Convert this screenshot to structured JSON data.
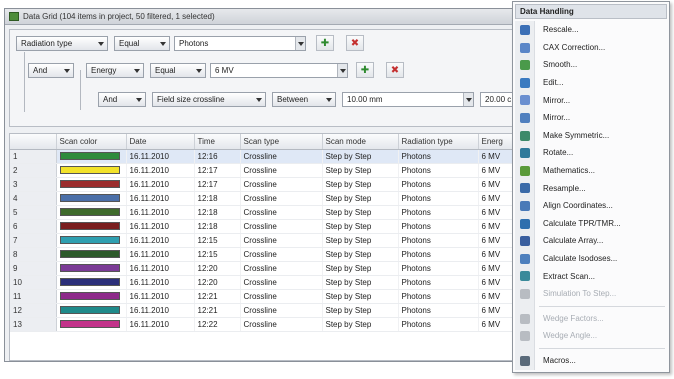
{
  "window": {
    "title": "Data Grid (104 items in project, 50 filtered, 1 selected)"
  },
  "filters": {
    "row1": {
      "field": "Radiation type",
      "op": "Equal",
      "value": "Photons"
    },
    "row2": {
      "logic": "And",
      "field": "Energy",
      "op": "Equal",
      "value": "6 MV"
    },
    "row3": {
      "logic": "And",
      "field": "Field size crossline",
      "op": "Between",
      "value1": "10.00 mm",
      "value2": "20.00 c"
    }
  },
  "grid": {
    "columns": [
      "",
      "Scan color",
      "Date",
      "Time",
      "Scan type",
      "Scan mode",
      "Radiation type",
      "Energ"
    ],
    "rows": [
      {
        "num": "1",
        "color": "#2e8b3c",
        "date": "16.11.2010",
        "time": "12:16",
        "type": "Crossline",
        "mode": "Step by Step",
        "rad": "Photons",
        "energy": "6 MV",
        "selected": true
      },
      {
        "num": "2",
        "color": "#f2e22a",
        "date": "16.11.2010",
        "time": "12:17",
        "type": "Crossline",
        "mode": "Step by Step",
        "rad": "Photons",
        "energy": "6 MV"
      },
      {
        "num": "3",
        "color": "#9b2c2c",
        "date": "16.11.2010",
        "time": "12:17",
        "type": "Crossline",
        "mode": "Step by Step",
        "rad": "Photons",
        "energy": "6 MV"
      },
      {
        "num": "4",
        "color": "#4b6fa8",
        "date": "16.11.2010",
        "time": "12:18",
        "type": "Crossline",
        "mode": "Step by Step",
        "rad": "Photons",
        "energy": "6 MV"
      },
      {
        "num": "5",
        "color": "#3f6b2c",
        "date": "16.11.2010",
        "time": "12:18",
        "type": "Crossline",
        "mode": "Step by Step",
        "rad": "Photons",
        "energy": "6 MV"
      },
      {
        "num": "6",
        "color": "#7a1e1e",
        "date": "16.11.2010",
        "time": "12:18",
        "type": "Crossline",
        "mode": "Step by Step",
        "rad": "Photons",
        "energy": "6 MV"
      },
      {
        "num": "7",
        "color": "#2f9fb0",
        "date": "16.11.2010",
        "time": "12:15",
        "type": "Crossline",
        "mode": "Step by Step",
        "rad": "Photons",
        "energy": "6 MV"
      },
      {
        "num": "8",
        "color": "#2d5a2a",
        "date": "16.11.2010",
        "time": "12:15",
        "type": "Crossline",
        "mode": "Step by Step",
        "rad": "Photons",
        "energy": "6 MV"
      },
      {
        "num": "9",
        "color": "#7b3b96",
        "date": "16.11.2010",
        "time": "12:20",
        "type": "Crossline",
        "mode": "Step by Step",
        "rad": "Photons",
        "energy": "6 MV"
      },
      {
        "num": "10",
        "color": "#2b2f7a",
        "date": "16.11.2010",
        "time": "12:20",
        "type": "Crossline",
        "mode": "Step by Step",
        "rad": "Photons",
        "energy": "6 MV"
      },
      {
        "num": "11",
        "color": "#8e2a8a",
        "date": "16.11.2010",
        "time": "12:21",
        "type": "Crossline",
        "mode": "Step by Step",
        "rad": "Photons",
        "energy": "6 MV"
      },
      {
        "num": "12",
        "color": "#1f8a8a",
        "date": "16.11.2010",
        "time": "12:21",
        "type": "Crossline",
        "mode": "Step by Step",
        "rad": "Photons",
        "energy": "6 MV"
      },
      {
        "num": "13",
        "color": "#c2338a",
        "date": "16.11.2010",
        "time": "12:22",
        "type": "Crossline",
        "mode": "Step by Step",
        "rad": "Photons",
        "energy": "6 MV"
      }
    ]
  },
  "menu": {
    "title": "Data Handling",
    "items": [
      {
        "label": "Rescale...",
        "icon": "rescale-icon",
        "color": "#3b6fb6",
        "disabled": false
      },
      {
        "label": "CAX Correction...",
        "icon": "cax-icon",
        "color": "#5a86c8",
        "disabled": false
      },
      {
        "label": "Smooth...",
        "icon": "smooth-icon",
        "color": "#4a9a4a",
        "disabled": false
      },
      {
        "label": "Edit...",
        "icon": "edit-icon",
        "color": "#3a7ac0",
        "disabled": false
      },
      {
        "label": "Mirror...",
        "icon": "mirror-icon",
        "color": "#6a8fd0",
        "disabled": false
      },
      {
        "label": "Mirror...",
        "icon": "mirror2-icon",
        "color": "#4f7fbf",
        "disabled": false
      },
      {
        "label": "Make Symmetric...",
        "icon": "symmetric-icon",
        "color": "#3d8a6a",
        "disabled": false
      },
      {
        "label": "Rotate...",
        "icon": "rotate-icon",
        "color": "#2f7a9a",
        "disabled": false
      },
      {
        "label": "Mathematics...",
        "icon": "math-icon",
        "color": "#5a9a3a",
        "disabled": false
      },
      {
        "label": "Resample...",
        "icon": "resample-icon",
        "color": "#3a6aa8",
        "disabled": false
      },
      {
        "label": "Align Coordinates...",
        "icon": "align-icon",
        "color": "#4a7ab8",
        "disabled": false
      },
      {
        "label": "Calculate TPR/TMR...",
        "icon": "tpr-icon",
        "color": "#2f6fae",
        "disabled": false
      },
      {
        "label": "Calculate Array...",
        "icon": "array-icon",
        "color": "#3a5f9f",
        "disabled": false
      },
      {
        "label": "Calculate Isodoses...",
        "icon": "isodose-icon",
        "color": "#4d7fbd",
        "disabled": false
      },
      {
        "label": "Extract Scan...",
        "icon": "extract-icon",
        "color": "#3a8a9a",
        "disabled": false
      },
      {
        "label": "Simulation To Step...",
        "icon": "simulation-icon",
        "color": "#b8bcc2",
        "disabled": true
      },
      {
        "separator": true
      },
      {
        "label": "Wedge Factors...",
        "icon": "wedge-factors-icon",
        "color": "#b8bcc2",
        "disabled": true
      },
      {
        "label": "Wedge Angle...",
        "icon": "wedge-angle-icon",
        "color": "#b8bcc2",
        "disabled": true
      },
      {
        "separator": true
      },
      {
        "label": "Macros...",
        "icon": "macros-icon",
        "color": "#5a6a7a",
        "disabled": false
      }
    ]
  }
}
